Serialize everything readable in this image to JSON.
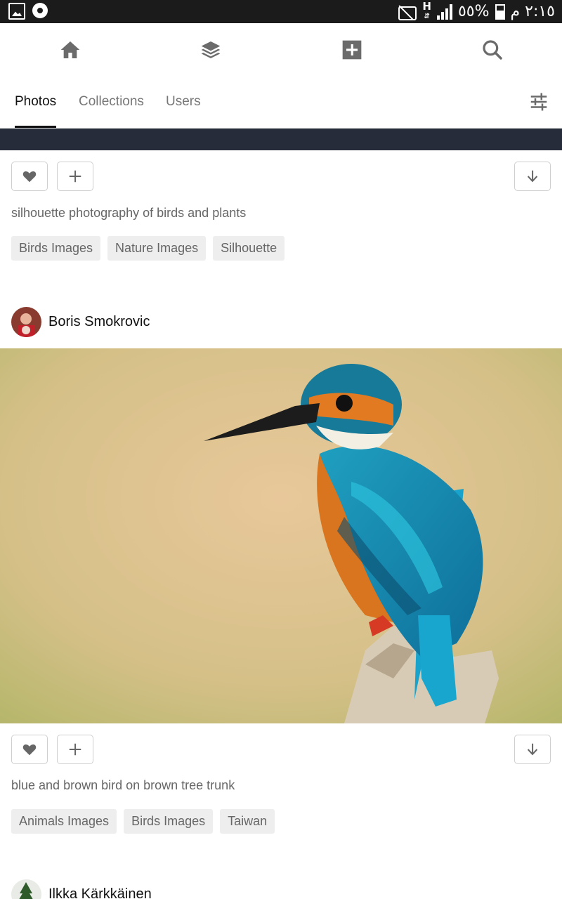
{
  "status_bar": {
    "battery": "٥٥%",
    "time": "٢:١٥ م",
    "network": "H"
  },
  "nav": {
    "icons": [
      "home-icon",
      "layers-icon",
      "add-box-icon",
      "search-icon"
    ]
  },
  "tabs": {
    "items": [
      {
        "label": "Photos",
        "active": true
      },
      {
        "label": "Collections",
        "active": false
      },
      {
        "label": "Users",
        "active": false
      }
    ],
    "filter_icon": "tune-icon"
  },
  "feed": {
    "post1": {
      "description": "silhouette photography of birds and plants",
      "tags": [
        "Birds Images",
        "Nature Images",
        "Silhouette"
      ]
    },
    "post2": {
      "author": "Boris Smokrovic",
      "description": "blue and brown bird on brown tree trunk",
      "tags": [
        "Animals Images",
        "Birds Images",
        "Taiwan"
      ]
    },
    "post3": {
      "author": "Ilkka Kärkkäinen"
    }
  },
  "colors": {
    "accent": "#111111",
    "tab_inactive": "#777777",
    "tag_bg": "#eeeeee",
    "status_bar": "#1b1b1b"
  }
}
